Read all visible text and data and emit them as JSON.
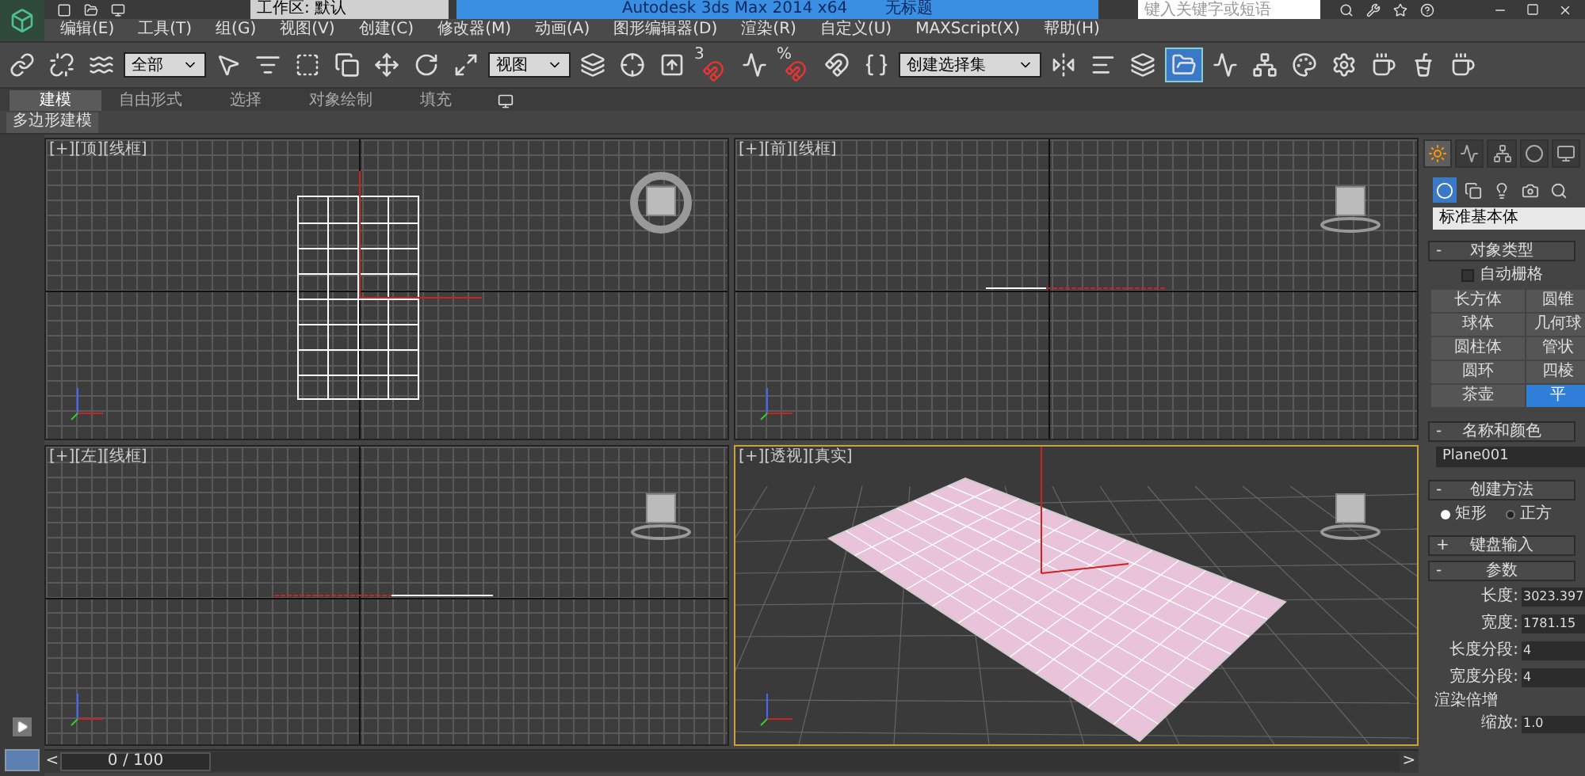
{
  "title_bar": {
    "workspace": "工作区: 默认",
    "title": "Autodesk 3ds Max  2014 x64",
    "document": "无标题",
    "search": {
      "placeholder": "键入关键字或短语"
    }
  },
  "menu": [
    "编辑(E)",
    "工具(T)",
    "组(G)",
    "视图(V)",
    "创建(C)",
    "修改器(M)",
    "动画(A)",
    "图形编辑器(D)",
    "渲染(R)",
    "自定义(U)",
    "MAXScript(X)",
    "帮助(H)"
  ],
  "toolbar": {
    "selection_filter": "全部",
    "reference_coordinate": "视图",
    "named_selection": "创建选择集",
    "snap_labels": [
      "3",
      "%"
    ],
    "explorer_active": true
  },
  "ribbon": {
    "tabs": [
      {
        "label": "建模",
        "selected": true
      },
      {
        "label": "自由形式",
        "selected": false
      },
      {
        "label": "选择",
        "selected": false
      },
      {
        "label": "对象绘制",
        "selected": false
      },
      {
        "label": "填充",
        "selected": false
      }
    ],
    "panel": "多边形建模"
  },
  "viewports": [
    {
      "kind": "top",
      "label": "[+][顶][线框]",
      "active": false
    },
    {
      "kind": "front",
      "label": "[+][前][线框]",
      "active": false
    },
    {
      "kind": "left",
      "label": "[+][左][线框]",
      "active": false
    },
    {
      "kind": "perspective",
      "label": "[+][透视][真实]",
      "active": true
    }
  ],
  "command_panel": {
    "tabs": [
      {
        "selected": true
      },
      {
        "selected": false
      },
      {
        "selected": false
      },
      {
        "selected": false
      },
      {
        "selected": false
      }
    ],
    "subtabs": [
      {
        "selected": true
      },
      {
        "selected": false
      },
      {
        "selected": false
      },
      {
        "selected": false
      },
      {
        "selected": false
      }
    ],
    "category": "标准基本体",
    "object_type": {
      "toggle": "-",
      "title": "对象类型",
      "autogrid": {
        "label": "自动栅格",
        "checked": false
      },
      "buttons": [
        {
          "label": "长方体",
          "selected": false
        },
        {
          "label": "圆锥",
          "selected": false
        },
        {
          "label": "球体",
          "selected": false
        },
        {
          "label": "几何球",
          "selected": false
        },
        {
          "label": "圆柱体",
          "selected": false
        },
        {
          "label": "管状",
          "selected": false
        },
        {
          "label": "圆环",
          "selected": false
        },
        {
          "label": "四棱",
          "selected": false
        },
        {
          "label": "茶壶",
          "selected": false
        },
        {
          "label": "平",
          "selected": true
        }
      ]
    },
    "name_color": {
      "toggle": "-",
      "title": "名称和颜色",
      "name": "Plane001"
    },
    "creation_method": {
      "toggle": "-",
      "title": "创建方法",
      "options": [
        {
          "label": "矩形",
          "selected": true
        },
        {
          "label": "正方",
          "selected": false
        }
      ]
    },
    "keyboard_entry": {
      "toggle": "+",
      "title": "键盘输入"
    },
    "parameters": {
      "toggle": "-",
      "title": "参数",
      "fields": [
        {
          "label": "长度:",
          "value": "3023.397"
        },
        {
          "label": "宽度:",
          "value": "1781.15"
        },
        {
          "label": "长度分段:",
          "value": "4"
        },
        {
          "label": "宽度分段:",
          "value": "4"
        }
      ],
      "render_group": "渲染倍增",
      "scale": {
        "label": "缩放:",
        "value": "1.0"
      }
    }
  },
  "time_slider": {
    "prev": "<",
    "frame": "0 / 100",
    "next": ">",
    "level": 0
  }
}
